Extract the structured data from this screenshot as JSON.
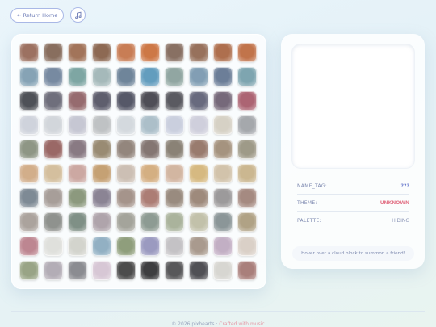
{
  "header": {
    "return_label": "← Return Home",
    "music_icon": "music-note-icon"
  },
  "grid": {
    "rows": [
      [
        "#a0705e",
        "#8a6e5c",
        "#a67356",
        "#906850",
        "#cf7c4f",
        "#d5763f",
        "#8a7061",
        "#9a7059",
        "#b46e49",
        "#c87245"
      ],
      [
        "#83a4b8",
        "#758aa4",
        "#7aa7a4",
        "#a3b9bb",
        "#6d859d",
        "#5e9ec3",
        "#8fa7a2",
        "#7f9fb7",
        "#6a7e9b",
        "#7ba6b2"
      ],
      [
        "#4e5158",
        "#6f6f7d",
        "#9a6a6e",
        "#5e5e6f",
        "#56586a",
        "#4f4e57",
        "#5a5a62",
        "#686a80",
        "#77697b",
        "#b26273"
      ],
      [
        "#cfd3dd",
        "#d2d6dc",
        "#c6c7d4",
        "#bfc2c4",
        "#d3d9df",
        "#aabfcb",
        "#c9cfe0",
        "#cfcfdd",
        "#d6d1c4",
        "#a5a8ad"
      ],
      [
        "#8d9684",
        "#9e6765",
        "#8a7a84",
        "#9a8b70",
        "#94867c",
        "#857671",
        "#8b8275",
        "#9c7a6c",
        "#a7937c",
        "#9f9a86"
      ],
      [
        "#d5ad86",
        "#d6bf9a",
        "#cfa7a1",
        "#c9a16f",
        "#cdbfb2",
        "#d8ae7c",
        "#d5b59e",
        "#d9b97a",
        "#d3c3a8",
        "#cdb78c"
      ],
      [
        "#7d8a96",
        "#a89e98",
        "#8b9a7c",
        "#8b8496",
        "#a6948a",
        "#b07c73",
        "#9a8b7d",
        "#a08a7a",
        "#9c9a9b",
        "#a7897f"
      ],
      [
        "#aca39c",
        "#8f928e",
        "#7e9085",
        "#b0a4ab",
        "#a4a49a",
        "#8c9b92",
        "#a9b39a",
        "#c2c1a8",
        "#8a9698",
        "#b1a282"
      ],
      [
        "#c28591",
        "#dfe0dc",
        "#d3d4cc",
        "#8fb1c6",
        "#8e9f79",
        "#9b9ac4",
        "#c4c2c5",
        "#aa9a8c",
        "#c4aec6",
        "#dbd0c6"
      ],
      [
        "#98a583",
        "#b3adb7",
        "#8b8c91",
        "#d8c7d6",
        "#4c4c4c",
        "#3e3e40",
        "#58585a",
        "#505055",
        "#d7d6d1",
        "#ad7e7a"
      ]
    ]
  },
  "info": {
    "rows": [
      {
        "label": "NAME_TAG:",
        "value": "???",
        "color": "#6f7fcf"
      },
      {
        "label": "THEME:",
        "value": "UNKNOWN",
        "color": "#e3788b"
      },
      {
        "label": "PALETTE:",
        "value": "HIDING",
        "color": "#8792b5"
      }
    ],
    "hint": "Hover over a cloud block to summon a friend!"
  },
  "footer": {
    "copyright": "© 2026 pixhearts",
    "separator": "·",
    "crafted": "Crafted with music"
  }
}
